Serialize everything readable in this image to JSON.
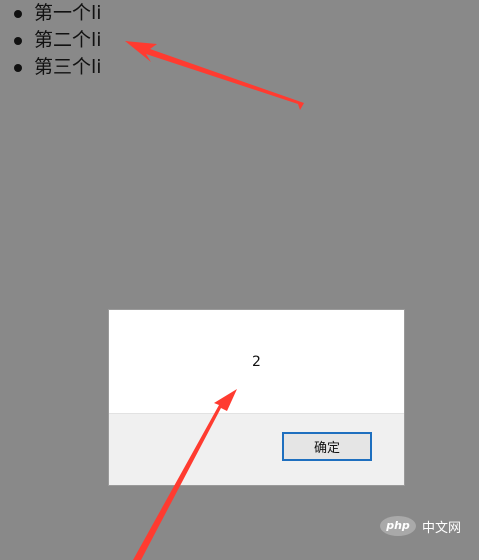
{
  "list": {
    "items": [
      "第一个li",
      "第二个li",
      "第三个li"
    ]
  },
  "dialog": {
    "message": "2",
    "ok_label": "确定"
  },
  "watermark": {
    "logo_text": "php",
    "site_text": "中文网"
  },
  "colors": {
    "background": "#898989",
    "arrow": "#ff3b30",
    "button_border": "#1e6fbf"
  }
}
